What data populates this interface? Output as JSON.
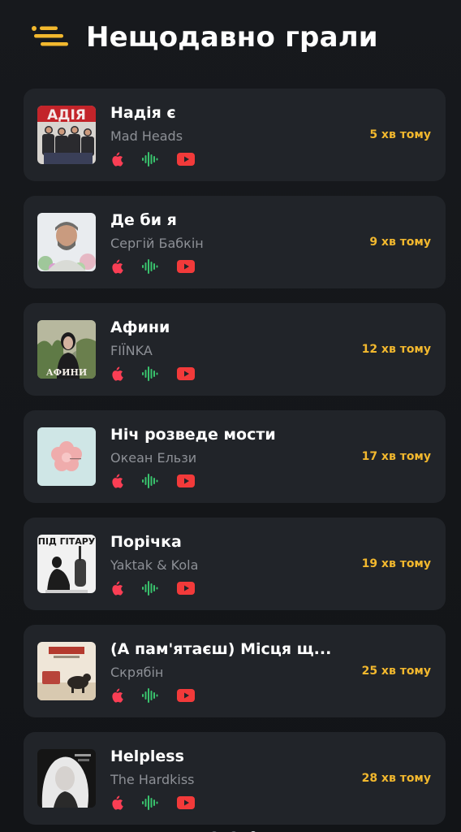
{
  "header": {
    "title": "Нещодавно грали",
    "menu_icon": "menu-lines-icon"
  },
  "colors": {
    "accent": "#f2b82e",
    "card": "#212429",
    "apple_music": "#fa3e54",
    "deezer": "#39c36d",
    "youtube": "#f23a3a"
  },
  "tracks": [
    {
      "title": "Надія є",
      "artist": "Mad Heads",
      "time": "5 хв тому"
    },
    {
      "title": "Де би я",
      "artist": "Сергій Бабкін",
      "time": "9 хв тому"
    },
    {
      "title": "Афини",
      "artist": "FIЇNKA",
      "time": "12 хв тому"
    },
    {
      "title": "Ніч розведе мости",
      "artist": "Океан Ельзи",
      "time": "17 хв тому"
    },
    {
      "title": "Порічка",
      "artist": "Yaktak & Kola",
      "time": "19 хв тому"
    },
    {
      "title": "(А пам'ятаєш) Місця щ...",
      "artist": "Скрябін",
      "time": "25 хв тому"
    },
    {
      "title": "Helpless",
      "artist": "The Hardkiss",
      "time": "28 хв тому"
    }
  ],
  "covers": {
    "0": {
      "text": "АДІЯ"
    },
    "2": {
      "text": "АФИНИ"
    },
    "4": {
      "text": "ПІД ГІТАРУ"
    }
  },
  "services": [
    "apple-music-icon",
    "waveform-icon",
    "youtube-icon"
  ]
}
